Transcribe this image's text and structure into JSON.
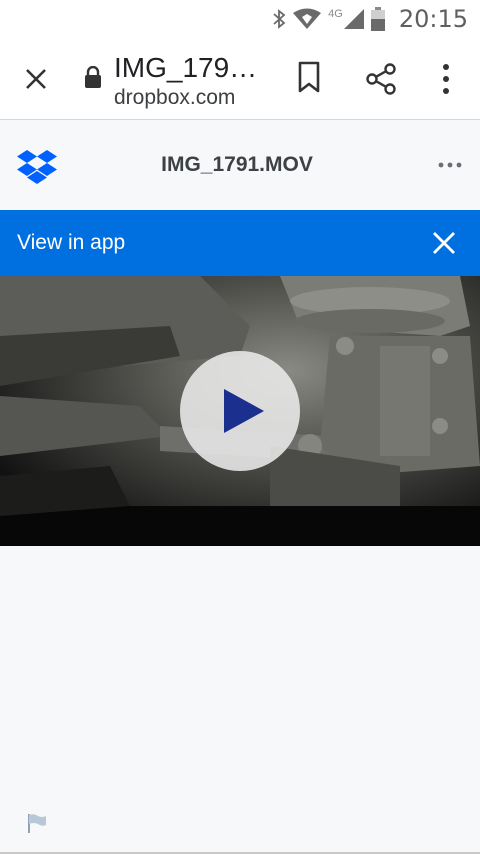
{
  "status_bar": {
    "network": "4G",
    "time": "20:15",
    "icons": [
      "bluetooth-icon",
      "wifi-icon",
      "signal-icon",
      "battery-icon"
    ]
  },
  "browser": {
    "title": "IMG_179…",
    "domain": "dropbox.com",
    "icons": [
      "close-icon",
      "lock-icon",
      "bookmark-icon",
      "share-icon",
      "more-vert-icon"
    ]
  },
  "header": {
    "file_name": "IMG_1791.MOV",
    "logo": "dropbox-logo",
    "menu_icon": "more-horiz-icon"
  },
  "banner": {
    "label": "View in app",
    "close_icon": "close-icon"
  },
  "video": {
    "play_icon": "play-icon"
  },
  "footer": {
    "icon": "flag-icon"
  },
  "colors": {
    "accent": "#0070e0",
    "dropbox_blue": "#0061fe",
    "play": "#1b2f8f",
    "page_bg": "#f7f8fa"
  }
}
